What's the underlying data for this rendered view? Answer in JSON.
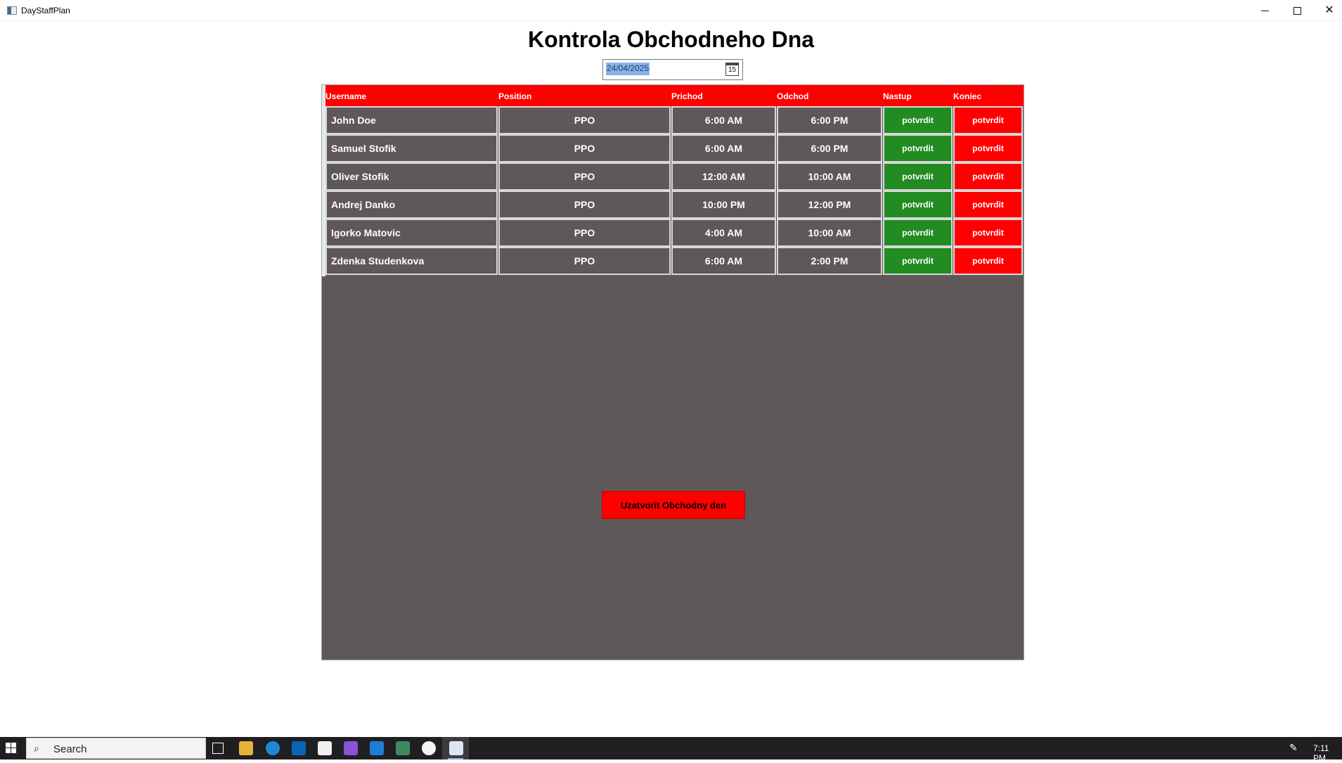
{
  "window": {
    "title": "DayStaffPlan",
    "minimize_glyph": "",
    "maximize_glyph": "",
    "close_glyph": "✕"
  },
  "page": {
    "title": "Kontrola Obchodneho Dna"
  },
  "date_picker": {
    "value": "24/04/2025",
    "calendar_day": "15"
  },
  "table": {
    "columns": [
      "Username",
      "Position",
      "Prichod",
      "Odchod",
      "Nastup",
      "Koniec"
    ],
    "rows": [
      {
        "username": "John Doe",
        "position": "PPO",
        "arrival": "6:00 AM",
        "departure": "6:00 PM",
        "start_action": "potvrdit",
        "end_action": "potvrdit"
      },
      {
        "username": "Samuel Stofik",
        "position": "PPO",
        "arrival": "6:00 AM",
        "departure": "6:00 PM",
        "start_action": "potvrdit",
        "end_action": "potvrdit"
      },
      {
        "username": "Oliver Stofik",
        "position": "PPO",
        "arrival": "12:00 AM",
        "departure": "10:00 AM",
        "start_action": "potvrdit",
        "end_action": "potvrdit"
      },
      {
        "username": "Andrej Danko",
        "position": "PPO",
        "arrival": "10:00 PM",
        "departure": "12:00 PM",
        "start_action": "potvrdit",
        "end_action": "potvrdit"
      },
      {
        "username": "Igorko Matovic",
        "position": "PPO",
        "arrival": "4:00 AM",
        "departure": "10:00 AM",
        "start_action": "potvrdit",
        "end_action": "potvrdit"
      },
      {
        "username": "Zdenka Studenkova",
        "position": "PPO",
        "arrival": "6:00 AM",
        "departure": "2:00 PM",
        "start_action": "potvrdit",
        "end_action": "potvrdit"
      }
    ]
  },
  "close_day_button": {
    "label": "Uzatvorit Obchodny den"
  },
  "taskbar": {
    "search_label": "Search",
    "clock": "7:11 PM"
  },
  "colors": {
    "header_red": "#ff0000",
    "confirm_green": "#228b22",
    "grid_background": "#5e5858"
  }
}
